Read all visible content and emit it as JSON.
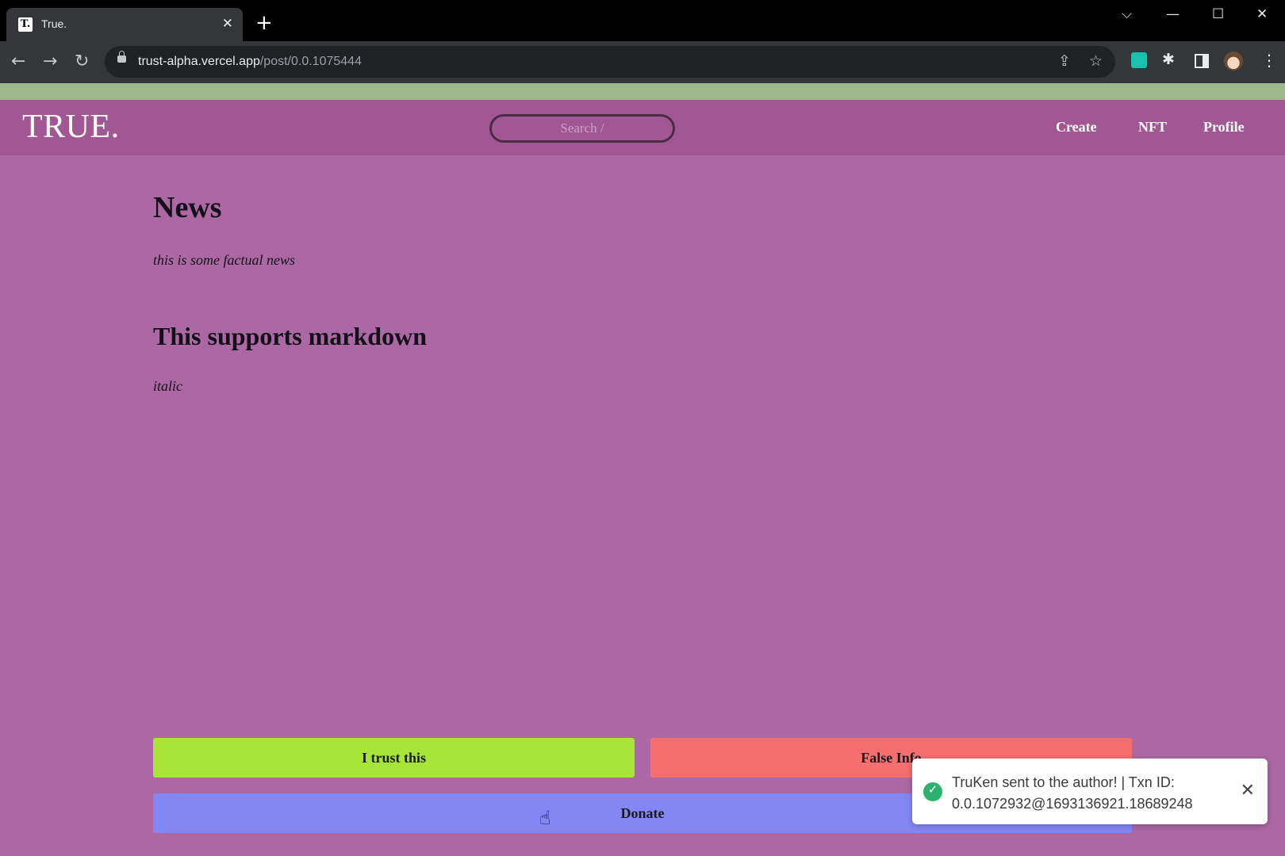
{
  "browser": {
    "tab_title": "True.",
    "favicon_letter": "T.",
    "url_host": "trust-alpha.vercel.app",
    "url_path": "/post/0.0.1075444"
  },
  "site": {
    "logo": "TRUE.",
    "search_placeholder": "Search /",
    "nav": {
      "create": "Create",
      "nft": "NFT",
      "profile": "Profile"
    }
  },
  "post": {
    "title": "News",
    "body": "this is some factual news",
    "markdown_heading": "This supports markdown",
    "markdown_italic": "italic"
  },
  "actions": {
    "trust_label": "I trust this",
    "false_label": "False Info",
    "donate_label": "Donate"
  },
  "toast": {
    "message_line1": "TruKen sent to the author! | Txn ID:",
    "message_line2": "0.0.1072932@1693136921.18689248"
  },
  "colors": {
    "page_bg": "#ac68a4",
    "header_bg": "#a15794",
    "trust": "#a5e636",
    "false_info": "#f66f70",
    "donate": "#8287f5",
    "success": "#2bb36d"
  },
  "icons": [
    "favicon",
    "close-icon",
    "plus-icon",
    "back-arrow-icon",
    "forward-arrow-icon",
    "reload-icon",
    "lock-icon",
    "share-icon",
    "star-icon",
    "extension-icon",
    "puzzle-icon",
    "side-panel-icon",
    "avatar",
    "menu-icon",
    "check-circle-icon",
    "pointer-cursor-icon"
  ]
}
